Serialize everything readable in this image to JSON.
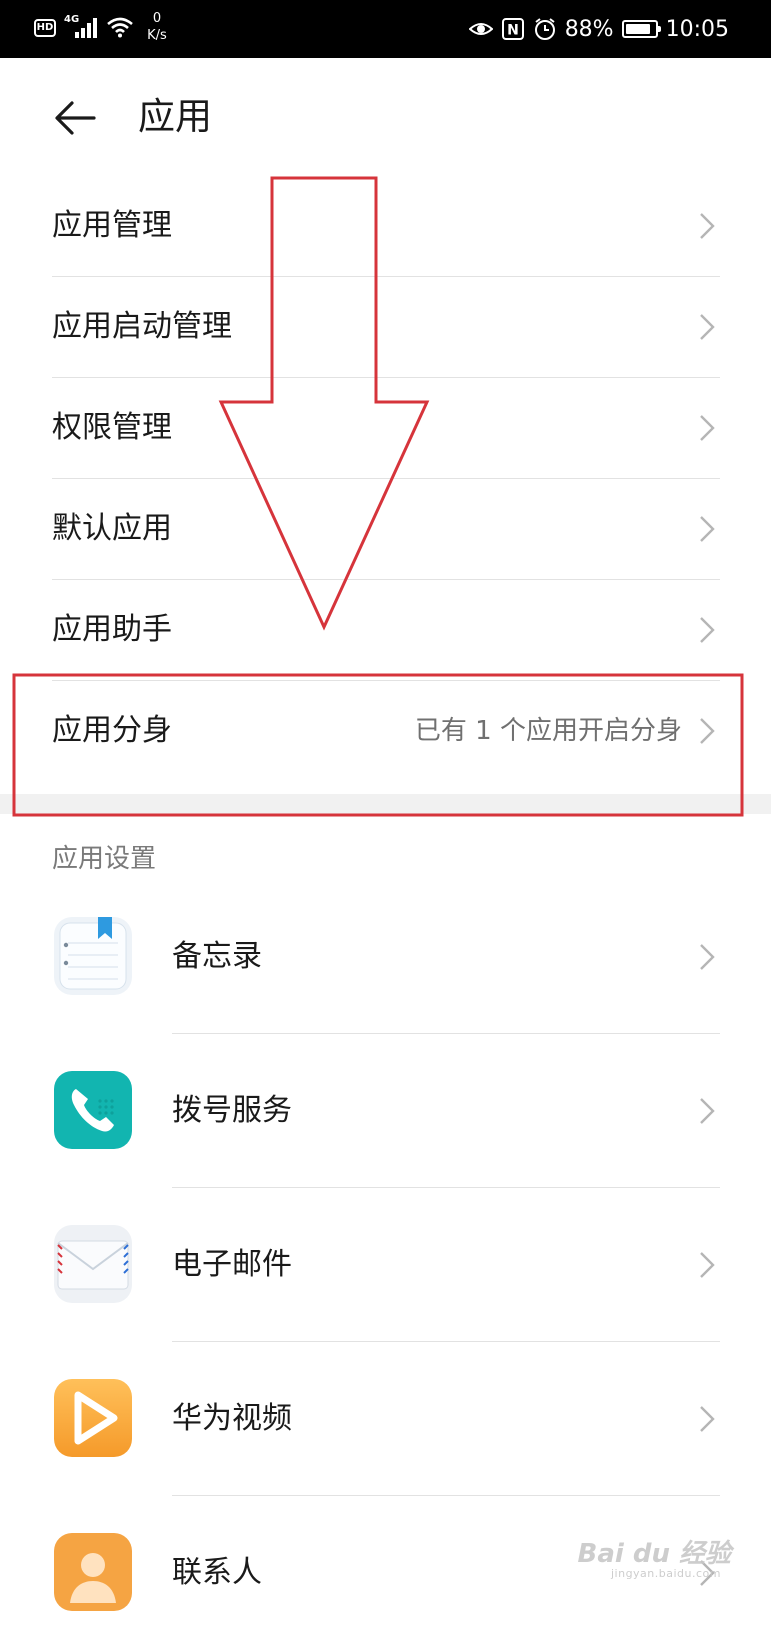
{
  "status_bar": {
    "hd": "HD",
    "network": "4G",
    "speed_value": "0",
    "speed_unit": "K/s",
    "nfc": "N",
    "battery_percent": "88%",
    "battery_level": 0.88,
    "time": "10:05"
  },
  "header": {
    "title": "应用"
  },
  "menu": [
    {
      "label": "应用管理"
    },
    {
      "label": "应用启动管理"
    },
    {
      "label": "权限管理"
    },
    {
      "label": "默认应用"
    },
    {
      "label": "应用助手"
    },
    {
      "label": "应用分身",
      "sub": "已有 1 个应用开启分身"
    }
  ],
  "section": {
    "label": "应用设置"
  },
  "apps": [
    {
      "label": "备忘录",
      "icon": "notepad-icon"
    },
    {
      "label": "拨号服务",
      "icon": "phone-icon"
    },
    {
      "label": "电子邮件",
      "icon": "mail-icon"
    },
    {
      "label": "华为视频",
      "icon": "play-icon"
    },
    {
      "label": "联系人",
      "icon": "contact-icon"
    }
  ],
  "annotation_color": "#d6343b",
  "watermark": {
    "main": "Bai du 经验",
    "small": "jingyan.baidu.com"
  }
}
